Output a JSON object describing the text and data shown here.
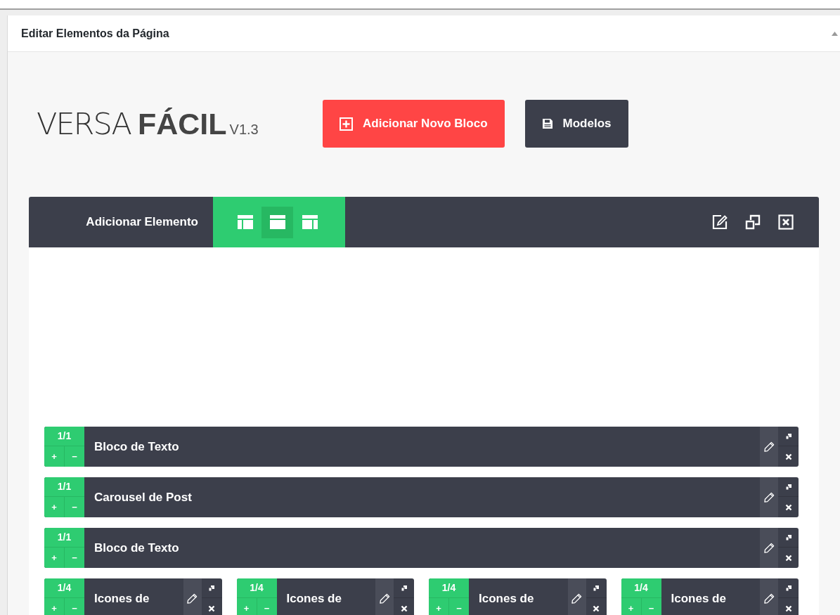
{
  "panel": {
    "title": "Editar Elementos da Página"
  },
  "logo": {
    "light": "VERSA",
    "bold": "FÁCIL",
    "version": "V1.3"
  },
  "buttons": [
    {
      "kind": "add",
      "label": "Adicionar Novo Bloco"
    },
    {
      "kind": "templates",
      "label": "Modelos"
    }
  ],
  "block": {
    "add_label": "Adicionar Elemento",
    "layouts": [
      {
        "kind": "left",
        "selected": false
      },
      {
        "kind": "full",
        "selected": true
      },
      {
        "kind": "right",
        "selected": false
      }
    ],
    "rows": [
      {
        "elements": [
          {
            "size": "1/1",
            "plus": "+",
            "minus": "−",
            "title": "Bloco de Texto"
          }
        ]
      },
      {
        "elements": [
          {
            "size": "1/1",
            "plus": "+",
            "minus": "−",
            "title": "Carousel de Post"
          }
        ]
      },
      {
        "elements": [
          {
            "size": "1/1",
            "plus": "+",
            "minus": "−",
            "title": "Bloco de Texto"
          }
        ]
      },
      {
        "elements": [
          {
            "size": "1/4",
            "plus": "+",
            "minus": "−",
            "title": "Icones de"
          },
          {
            "size": "1/4",
            "plus": "+",
            "minus": "−",
            "title": "Icones de"
          },
          {
            "size": "1/4",
            "plus": "+",
            "minus": "−",
            "title": "Icones de"
          },
          {
            "size": "1/4",
            "plus": "+",
            "minus": "−",
            "title": "Icones de"
          }
        ]
      }
    ]
  }
}
